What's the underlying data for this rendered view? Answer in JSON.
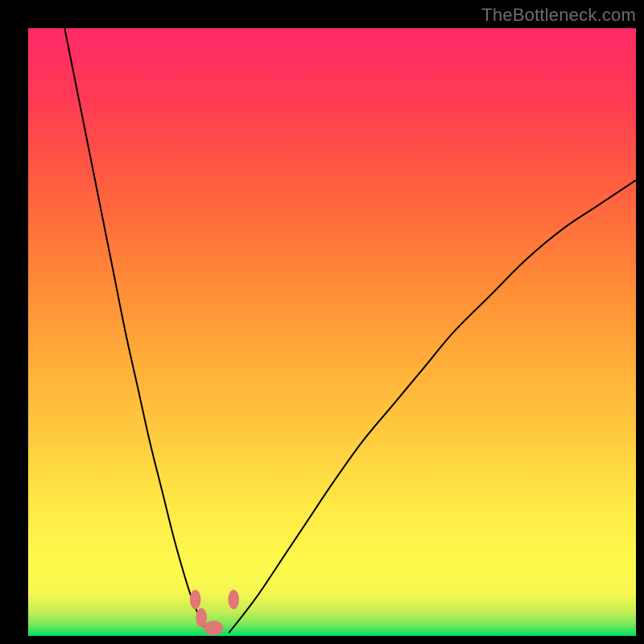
{
  "watermark": "TheBottleneck.com",
  "colors": {
    "page_bg": "#000000",
    "gradient_top": "#FF2A68",
    "gradient_bottom": "#00E060",
    "curve": "#000000",
    "marker": "#E07878"
  },
  "chart_data": {
    "type": "line",
    "title": "",
    "xlabel": "",
    "ylabel": "",
    "xlim": [
      0,
      100
    ],
    "ylim": [
      0,
      100
    ],
    "grid": false,
    "legend": false,
    "note": "A bottleneck curve: two branches descending to a narrow minimum near x≈30 (y≈0), rising steeply on both sides. Axis tick labels are not shown; x values are normalized 0–100 across the plot width and y values 0–100 across height.",
    "series": [
      {
        "name": "left-branch",
        "x": [
          6,
          8,
          10,
          12,
          14,
          16,
          18,
          20,
          22,
          24,
          26,
          27,
          28,
          29,
          30
        ],
        "y": [
          100,
          90,
          80,
          70,
          60,
          50,
          41,
          32,
          24,
          16,
          9,
          6,
          3.5,
          1.5,
          0.5
        ]
      },
      {
        "name": "right-branch",
        "x": [
          33,
          35,
          38,
          42,
          46,
          50,
          55,
          60,
          65,
          70,
          76,
          82,
          88,
          94,
          100
        ],
        "y": [
          0.5,
          3,
          7,
          13,
          19,
          25,
          32,
          38,
          44,
          50,
          56,
          62,
          67,
          71,
          75
        ]
      }
    ],
    "markers": [
      {
        "x": 27.5,
        "y": 6.0,
        "rx": 0.9,
        "ry": 1.6
      },
      {
        "x": 28.5,
        "y": 3.0,
        "rx": 0.9,
        "ry": 1.6
      },
      {
        "x": 30.5,
        "y": 1.3,
        "rx": 1.6,
        "ry": 1.2
      },
      {
        "x": 33.8,
        "y": 6.0,
        "rx": 0.9,
        "ry": 1.6
      }
    ]
  }
}
